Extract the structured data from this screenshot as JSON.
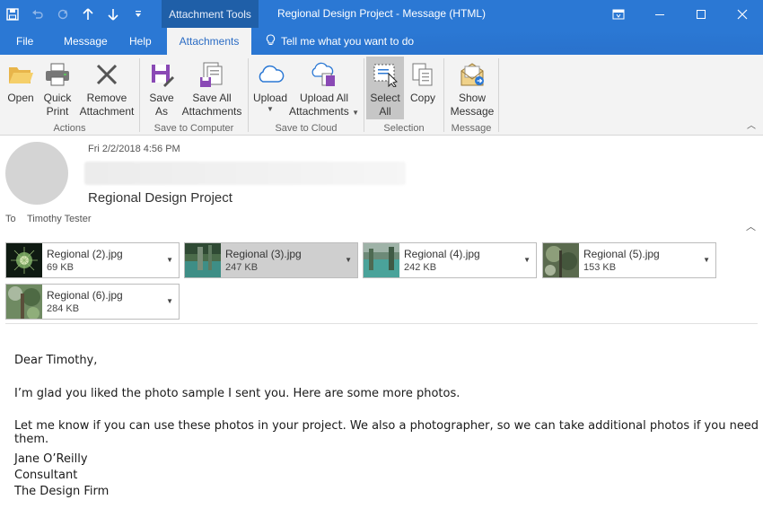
{
  "titlebar": {
    "context_tab": "Attachment Tools",
    "title": "Regional Design Project  -  Message (HTML)",
    "qat": [
      "save-icon",
      "undo-icon",
      "redo-icon",
      "up-arrow-icon",
      "down-arrow-icon",
      "customize-qat-icon"
    ],
    "controls": [
      "ribbon-display-icon",
      "minimize-icon",
      "maximize-icon",
      "close-icon"
    ]
  },
  "tabs": {
    "file": "File",
    "message": "Message",
    "help": "Help",
    "attachments": "Attachments",
    "tellme": "Tell me what you want to do"
  },
  "ribbon": {
    "groups": {
      "actions": "Actions",
      "save_to_computer": "Save to Computer",
      "save_to_cloud": "Save to Cloud",
      "selection": "Selection",
      "message": "Message"
    },
    "buttons": {
      "open": "Open",
      "quick_print_1": "Quick",
      "quick_print_2": "Print",
      "remove_1": "Remove",
      "remove_2": "Attachment",
      "save_as_1": "Save",
      "save_as_2": "As",
      "save_all_1": "Save All",
      "save_all_2": "Attachments",
      "upload": "Upload",
      "upload_all_1": "Upload All",
      "upload_all_2": "Attachments",
      "select_all_1": "Select",
      "select_all_2": "All",
      "copy": "Copy",
      "show_message_1": "Show",
      "show_message_2": "Message"
    }
  },
  "message": {
    "date": "Fri 2/2/2018 4:56 PM",
    "subject": "Regional Design Project",
    "to_label": "To",
    "to_name": "Timothy Tester"
  },
  "attachments": [
    {
      "name": "Regional (2).jpg",
      "size": "69 KB"
    },
    {
      "name": "Regional (3).jpg",
      "size": "247 KB"
    },
    {
      "name": "Regional (4).jpg",
      "size": "242 KB"
    },
    {
      "name": "Regional (5).jpg",
      "size": "153 KB"
    },
    {
      "name": "Regional (6).jpg",
      "size": "284 KB"
    }
  ],
  "body": {
    "greeting": "Dear Timothy,",
    "para1": "I’m glad you liked the photo sample I sent you. Here are some more photos.",
    "para2": "Let me know if you can use these photos in your project. We also a photographer, so we can take additional photos if you need them.",
    "sig_name": "Jane O’Reilly",
    "sig_title": "Consultant",
    "sig_company": "The Design Firm"
  },
  "colors": {
    "accent": "#2b78d4",
    "context_tab": "#1f5fa8",
    "ribbon_bg": "#f3f3f3",
    "active_tab_text": "#2b6cc4",
    "selected_bg": "#c6c6c6"
  }
}
